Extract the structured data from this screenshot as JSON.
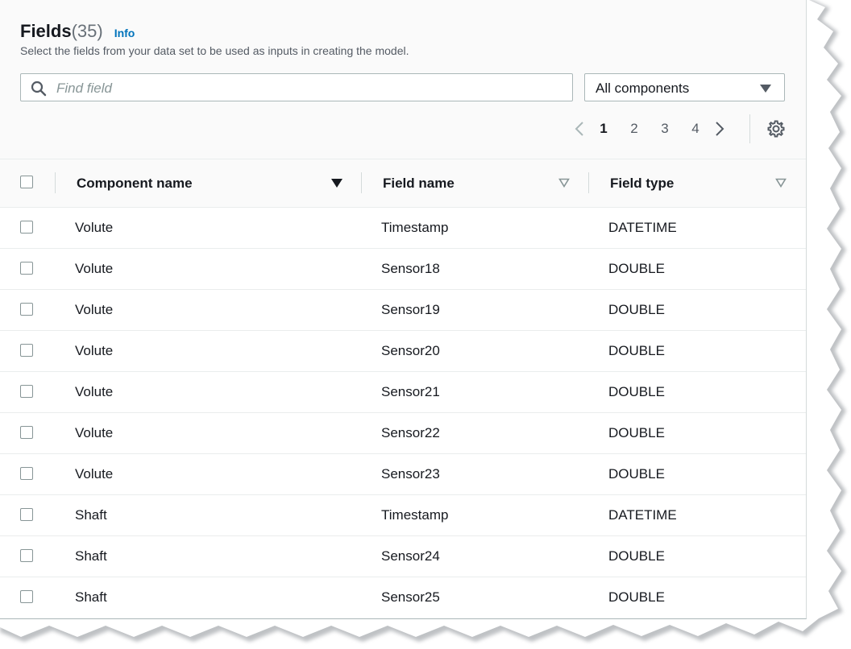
{
  "header": {
    "title": "Fields",
    "count": "(35)",
    "info_label": "Info",
    "description": "Select the fields from your data set to be used as inputs in creating the model."
  },
  "search": {
    "placeholder": "Find field",
    "value": "",
    "icon": "search-icon"
  },
  "filter": {
    "selected": "All components",
    "icon": "caret-down-icon"
  },
  "pagination": {
    "pages": [
      "1",
      "2",
      "3",
      "4"
    ],
    "current": "1",
    "prev_icon": "chevron-left-icon",
    "next_icon": "chevron-right-icon",
    "settings_icon": "gear-icon"
  },
  "table": {
    "columns": [
      {
        "label": "Component name",
        "sorted": true
      },
      {
        "label": "Field name",
        "sorted": false
      },
      {
        "label": "Field type",
        "sorted": false
      }
    ],
    "rows": [
      {
        "component": "Volute",
        "field": "Timestamp",
        "type": "DATETIME"
      },
      {
        "component": "Volute",
        "field": "Sensor18",
        "type": "DOUBLE"
      },
      {
        "component": "Volute",
        "field": "Sensor19",
        "type": "DOUBLE"
      },
      {
        "component": "Volute",
        "field": "Sensor20",
        "type": "DOUBLE"
      },
      {
        "component": "Volute",
        "field": "Sensor21",
        "type": "DOUBLE"
      },
      {
        "component": "Volute",
        "field": "Sensor22",
        "type": "DOUBLE"
      },
      {
        "component": "Volute",
        "field": "Sensor23",
        "type": "DOUBLE"
      },
      {
        "component": "Shaft",
        "field": "Timestamp",
        "type": "DATETIME"
      },
      {
        "component": "Shaft",
        "field": "Sensor24",
        "type": "DOUBLE"
      },
      {
        "component": "Shaft",
        "field": "Sensor25",
        "type": "DOUBLE"
      }
    ]
  },
  "colors": {
    "link": "#0073bb",
    "text": "#16191f",
    "muted": "#545b64",
    "border": "#aab7b8"
  }
}
